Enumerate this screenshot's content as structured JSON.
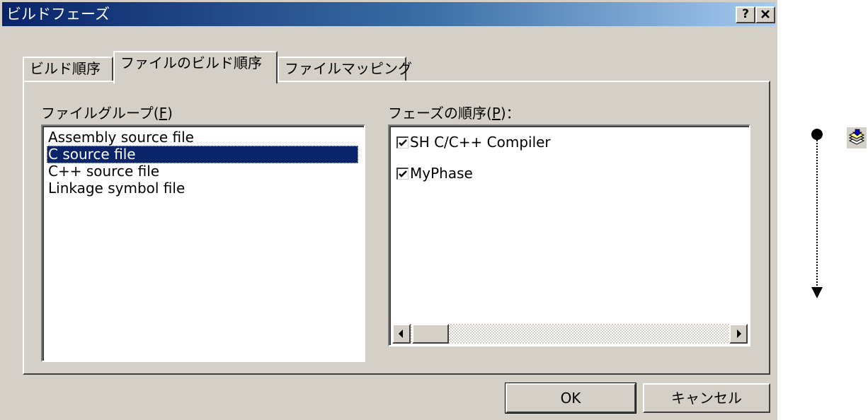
{
  "window": {
    "title": "ビルドフェーズ",
    "help_label": "?",
    "close_label": "✕"
  },
  "tabs": [
    {
      "label": "ビルド順序",
      "active": false
    },
    {
      "label": "ファイルのビルド順序",
      "active": true
    },
    {
      "label": "ファイルマッピング",
      "active": false
    }
  ],
  "file_group": {
    "label_prefix": "ファイルグループ(",
    "label_key": "F",
    "label_suffix": ")",
    "items": [
      {
        "label": "Assembly source file",
        "selected": false
      },
      {
        "label": "C source file",
        "selected": true
      },
      {
        "label": "C++ source file",
        "selected": false
      },
      {
        "label": "Linkage symbol file",
        "selected": false
      }
    ]
  },
  "phase_order": {
    "label_prefix": "フェーズの順序(",
    "label_key": "P",
    "label_suffix": ")：",
    "items": [
      {
        "label": "SH C/C++ Compiler",
        "checked": true
      },
      {
        "label": "MyPhase",
        "checked": true
      }
    ]
  },
  "buttons": {
    "ok": "OK",
    "cancel": "キャンセル"
  },
  "colors": {
    "title_start": "#0a246a",
    "title_end": "#a6caf0",
    "dialog_bg": "#d4d0c8",
    "selection": "#0a246a"
  },
  "side": {
    "arrow_icon": "down-arrow-timeline-icon",
    "stack_icon": "layers-icon"
  }
}
